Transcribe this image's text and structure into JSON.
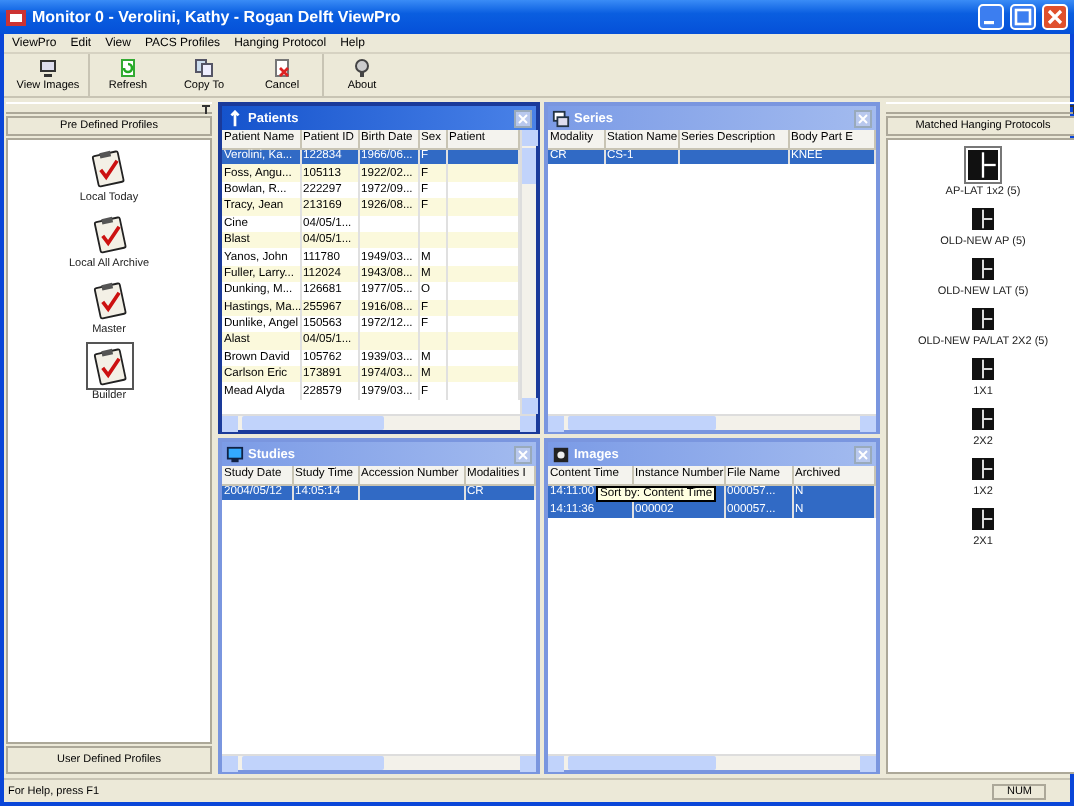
{
  "window": {
    "title": "Monitor 0 - Verolini, Kathy - Rogan Delft ViewPro"
  },
  "menu": [
    "ViewPro",
    "Edit",
    "View",
    "PACS Profiles",
    "Hanging Protocol",
    "Help"
  ],
  "toolbar": [
    {
      "label": "View Images",
      "kind": "monitor"
    },
    {
      "label": "Refresh",
      "kind": "refresh"
    },
    {
      "label": "Copy To",
      "kind": "copy"
    },
    {
      "label": "Cancel",
      "kind": "cancel"
    },
    {
      "label": "About",
      "kind": "about"
    }
  ],
  "profiles_panel": {
    "header": "Pre Defined Profiles",
    "footer": "User Defined Profiles",
    "items": [
      {
        "label": "Local Today",
        "selected": false
      },
      {
        "label": "Local All Archive",
        "selected": false
      },
      {
        "label": "Master",
        "selected": false
      },
      {
        "label": "Builder",
        "selected": true
      }
    ]
  },
  "panels": [
    {
      "title": "Patients",
      "kind": "patients",
      "active": true,
      "columns": [
        "Patient Name",
        "Patient ID",
        "Birth Date",
        "Sex",
        "Patient"
      ],
      "rows": [
        {
          "selected": true,
          "cells": [
            "Verolini, Ka...",
            "122834",
            "1966/06...",
            "F",
            null
          ]
        },
        {
          "selected": false,
          "cells": [
            "Foss, Angu...",
            "105113",
            "1922/02...",
            "F",
            null
          ]
        },
        {
          "selected": false,
          "cells": [
            "Bowlan, R...",
            "222297",
            "1972/09...",
            "F",
            null
          ]
        },
        {
          "selected": false,
          "cells": [
            "Tracy, Jean",
            "213169",
            "1926/08...",
            "F",
            null
          ]
        },
        {
          "selected": false,
          "cells": [
            "Cine",
            "04/05/1...",
            null,
            null,
            null
          ]
        },
        {
          "selected": false,
          "cells": [
            "Blast",
            "04/05/1...",
            null,
            null,
            null
          ]
        },
        {
          "selected": false,
          "cells": [
            "Yanos, John",
            "111780",
            "1949/03...",
            "M",
            null
          ]
        },
        {
          "selected": false,
          "cells": [
            "Fuller, Larry...",
            "112024",
            "1943/08...",
            "M",
            null
          ]
        },
        {
          "selected": false,
          "cells": [
            "Dunking, M...",
            "126681",
            "1977/05...",
            "O",
            null
          ]
        },
        {
          "selected": false,
          "cells": [
            "Hastings, Ma...",
            "255967",
            "1916/08...",
            "F",
            null
          ]
        },
        {
          "selected": false,
          "cells": [
            "Dunlike, Angel",
            "150563",
            "1972/12...",
            "F",
            null
          ]
        },
        {
          "selected": false,
          "cells": [
            "Alast",
            "04/05/1...",
            null,
            null,
            null
          ]
        },
        {
          "selected": false,
          "cells": [
            "Brown David",
            "105762",
            "1939/03...",
            "M",
            null
          ]
        },
        {
          "selected": false,
          "cells": [
            "Carlson Eric",
            "173891",
            "1974/03...",
            "M",
            null
          ]
        },
        {
          "selected": false,
          "cells": [
            "Mead Alyda",
            "228579",
            "1979/03...",
            "F",
            null
          ]
        }
      ]
    },
    {
      "title": "Series",
      "kind": "series",
      "active": false,
      "columns": [
        "Modality",
        "Station Name",
        "Series Description",
        "Body Part E"
      ],
      "rows": [
        {
          "selected": true,
          "cells": [
            "CR",
            "CS-1",
            null,
            "KNEE"
          ]
        }
      ]
    },
    {
      "title": "Studies",
      "kind": "studies",
      "active": false,
      "columns": [
        "Study Date",
        "Study Time",
        "Accession Number",
        "Modalities I"
      ],
      "rows": [
        {
          "selected": true,
          "cells": [
            "2004/05/12",
            "14:05:14",
            null,
            "CR"
          ]
        }
      ]
    },
    {
      "title": "Images",
      "kind": "images",
      "active": false,
      "tooltip": "Sort by: Content Time",
      "columns": [
        "Content Time",
        "Instance Number",
        "File Name",
        "Archived"
      ],
      "rows": [
        {
          "selected": true,
          "cells": [
            "14:11:00",
            null,
            "000057...",
            "N"
          ]
        },
        {
          "selected": true,
          "cells": [
            "14:11:36",
            "000002",
            "000057...",
            "N"
          ]
        }
      ]
    }
  ],
  "protocols_panel": {
    "header": "Matched Hanging Protocols",
    "items": [
      {
        "label": "AP-LAT 1x2 (5)",
        "selected": true
      },
      {
        "label": "OLD-NEW AP (5)",
        "selected": false
      },
      {
        "label": "OLD-NEW LAT (5)",
        "selected": false
      },
      {
        "label": "OLD-NEW PA/LAT 2X2 (5)",
        "selected": false
      },
      {
        "label": "1X1",
        "selected": false
      },
      {
        "label": "2X2",
        "selected": false
      },
      {
        "label": "1X2",
        "selected": false
      },
      {
        "label": "2X1",
        "selected": false
      }
    ]
  },
  "status_bar": {
    "message": "For Help, press F1",
    "indicator": "NUM"
  }
}
